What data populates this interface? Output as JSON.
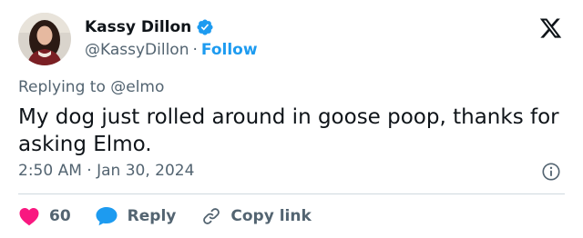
{
  "author": {
    "display_name": "Kassy Dillon",
    "handle": "@KassyDillon",
    "separator": "·",
    "follow_label": "Follow"
  },
  "tweet": {
    "replying_to": "Replying to @elmo",
    "text": "My dog just rolled around in goose poop, thanks for asking Elmo.",
    "timestamp": "2:50 AM · Jan 30, 2024"
  },
  "actions": {
    "like_count": "60",
    "reply_label": "Reply",
    "copy_link_label": "Copy link"
  },
  "icons": {
    "verified": "verified-badge-icon",
    "logo": "x-logo-icon",
    "info": "info-icon",
    "like": "heart-icon",
    "reply": "speech-bubble-icon",
    "copy": "link-icon"
  },
  "colors": {
    "accent": "#1d9bf0",
    "like": "#f91880",
    "text": "#0f1419",
    "muted": "#536471",
    "divider": "#cfd9de"
  }
}
